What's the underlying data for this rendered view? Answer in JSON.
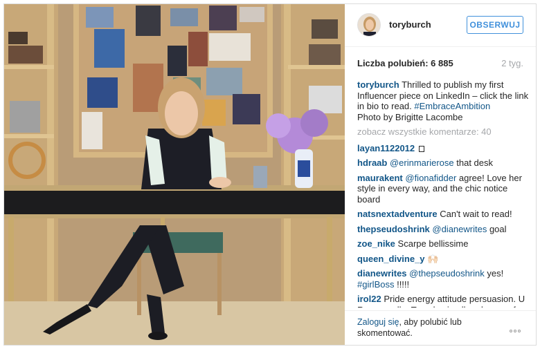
{
  "post": {
    "username": "toryburch",
    "follow_label": "OBSERWUJ",
    "likes_text": "Liczba polubień: 6 885",
    "time_ago": "2 tyg.",
    "caption": {
      "user": "toryburch",
      "text": "Thrilled to publish my first Influencer piece on LinkedIn – click the link in bio to read.",
      "hashtag": "#EmbraceAmbition",
      "credit": "Photo by Brigitte Lacombe"
    },
    "view_all_comments": "zobacz wszystkie komentarze: 40"
  },
  "comments": [
    {
      "user": "layan1122012",
      "text": ""
    },
    {
      "user": "hdraab",
      "mention": "@erinmarierose",
      "text": " that desk"
    },
    {
      "user": "maurakent",
      "mention": "@fionafidder",
      "text": " agree! Love her style in every way, and the chic notice board"
    },
    {
      "user": "natsnextadventure",
      "text": "Can't wait to read!"
    },
    {
      "user": "thepseudoshrink",
      "mention": "@dianewrites",
      "text": " goal"
    },
    {
      "user": "zoe_nike",
      "text": "Scarpe bellissime"
    },
    {
      "user": "queen_divine_y",
      "text": "🙌🏻"
    },
    {
      "user": "dianewrites",
      "mention": "@thepseudoshrink",
      "text": " yes!",
      "hashtag": "#girlBoss",
      "text2": " !!!!!"
    },
    {
      "user": "irol22",
      "text": "Pride energy attitude persuasion. U R very well a Ten plus in all endeavor of"
    }
  ],
  "footer": {
    "login_link": "Zaloguj się",
    "login_rest": ", aby polubić lub skomentować."
  },
  "icons": {
    "more": "more-options-icon",
    "avatar": "profile-avatar"
  },
  "colors": {
    "link_blue": "#125688",
    "follow_blue": "#4090db",
    "muted_gray": "#a5a7aa"
  }
}
